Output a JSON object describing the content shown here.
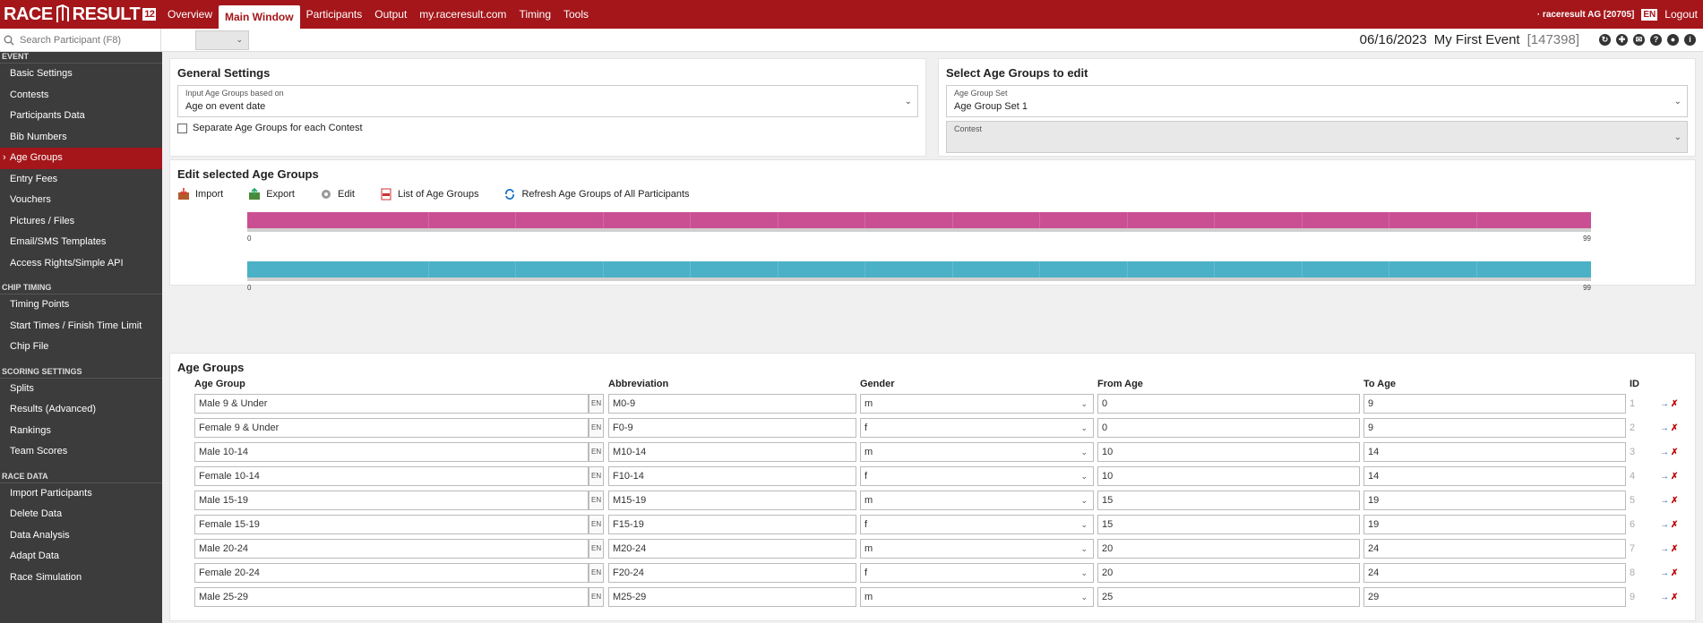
{
  "app": {
    "logo_left": "RACE",
    "logo_right": "RESULT",
    "logo_version": "12",
    "nav": [
      "Overview",
      "Main Window",
      "Participants",
      "Output",
      "my.raceresult.com",
      "Timing",
      "Tools"
    ],
    "account": "· raceresult AG [20705]",
    "language": "EN",
    "logout": "Logout"
  },
  "subbar": {
    "search_placeholder": "Search Participant (F8)",
    "date": "06/16/2023",
    "event_name": "My First Event",
    "event_id": "[147398]"
  },
  "sidebar": [
    {
      "section": "EVENT",
      "items": [
        "Basic Settings",
        "Contests",
        "Participants Data",
        "Bib Numbers",
        "Age Groups",
        "Entry Fees",
        "Vouchers",
        "Pictures / Files",
        "Email/SMS Templates",
        "Access Rights/Simple API"
      ]
    },
    {
      "section": "CHIP TIMING",
      "items": [
        "Timing Points",
        "Start Times / Finish Time Limit",
        "Chip File"
      ]
    },
    {
      "section": "SCORING SETTINGS",
      "items": [
        "Splits",
        "Results (Advanced)",
        "Rankings",
        "Team Scores"
      ]
    },
    {
      "section": "RACE DATA",
      "items": [
        "Import Participants",
        "Delete Data",
        "Data Analysis",
        "Adapt Data",
        "Race Simulation"
      ]
    }
  ],
  "sidebar_active": "Age Groups",
  "general": {
    "title": "General Settings",
    "input_label": "Input Age Groups based on",
    "input_value": "Age on event date",
    "separate_label": "Separate Age Groups for each Contest"
  },
  "select": {
    "title": "Select Age Groups to edit",
    "set_label": "Age Group Set",
    "set_value": "Age Group Set 1",
    "contest_label": "Contest"
  },
  "edit": {
    "title": "Edit selected Age Groups",
    "import": "Import",
    "export": "Export",
    "edit": "Edit",
    "list": "List of Age Groups",
    "refresh": "Refresh Age Groups of All Participants",
    "bar_min": "0",
    "bar_max": "99",
    "male_color": "#c94f92",
    "female_color": "#4bb1c6"
  },
  "table": {
    "title": "Age Groups",
    "headers": [
      "Age Group",
      "Abbreviation",
      "Gender",
      "From Age",
      "To Age",
      "ID"
    ],
    "lang_tag": "EN",
    "rows": [
      {
        "name": "Male 9 & Under",
        "abbr": "M0-9",
        "gender": "m",
        "from": "0",
        "to": "9",
        "id": "1"
      },
      {
        "name": "Female 9 & Under",
        "abbr": "F0-9",
        "gender": "f",
        "from": "0",
        "to": "9",
        "id": "2"
      },
      {
        "name": "Male 10-14",
        "abbr": "M10-14",
        "gender": "m",
        "from": "10",
        "to": "14",
        "id": "3"
      },
      {
        "name": "Female 10-14",
        "abbr": "F10-14",
        "gender": "f",
        "from": "10",
        "to": "14",
        "id": "4"
      },
      {
        "name": "Male 15-19",
        "abbr": "M15-19",
        "gender": "m",
        "from": "15",
        "to": "19",
        "id": "5"
      },
      {
        "name": "Female 15-19",
        "abbr": "F15-19",
        "gender": "f",
        "from": "15",
        "to": "19",
        "id": "6"
      },
      {
        "name": "Male 20-24",
        "abbr": "M20-24",
        "gender": "m",
        "from": "20",
        "to": "24",
        "id": "7"
      },
      {
        "name": "Female 20-24",
        "abbr": "F20-24",
        "gender": "f",
        "from": "20",
        "to": "24",
        "id": "8"
      },
      {
        "name": "Male 25-29",
        "abbr": "M25-29",
        "gender": "m",
        "from": "25",
        "to": "29",
        "id": "9"
      }
    ]
  }
}
